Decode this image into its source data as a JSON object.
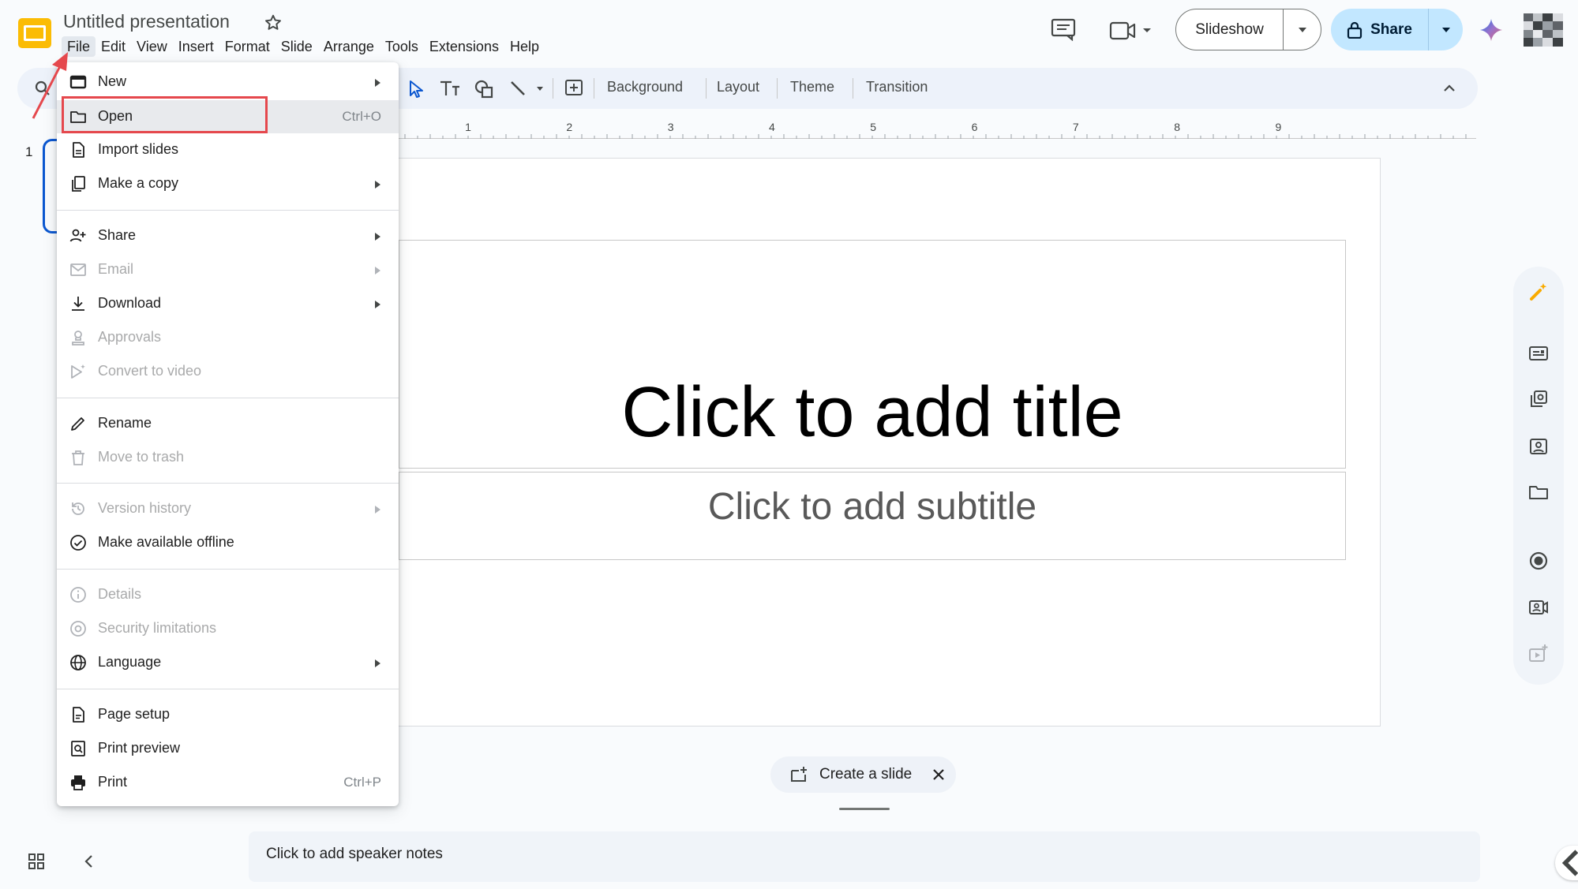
{
  "app": {
    "doc_title": "Untitled presentation",
    "menus": [
      "File",
      "Edit",
      "View",
      "Insert",
      "Format",
      "Slide",
      "Arrange",
      "Tools",
      "Extensions",
      "Help"
    ],
    "active_menu": "File"
  },
  "header": {
    "slideshow_label": "Slideshow",
    "share_label": "Share"
  },
  "toolbar": {
    "background_label": "Background",
    "layout_label": "Layout",
    "theme_label": "Theme",
    "transition_label": "Transition"
  },
  "ruler": {
    "ticks": [
      "1",
      "2",
      "3",
      "4",
      "5",
      "6",
      "7",
      "8",
      "9"
    ]
  },
  "filmstrip": {
    "slide_number": "1"
  },
  "slide": {
    "title_placeholder": "Click to add title",
    "subtitle_placeholder": "Click to add subtitle"
  },
  "create_slide_label": "Create a slide",
  "speaker_notes_placeholder": "Click to add speaker notes",
  "file_menu": {
    "items": [
      {
        "label": "New",
        "icon": "new-presentation-icon",
        "submenu": true,
        "disabled": false
      },
      {
        "label": "Open",
        "icon": "folder-icon",
        "shortcut": "Ctrl+O",
        "disabled": false,
        "highlighted": true
      },
      {
        "label": "Import slides",
        "icon": "import-slides-icon",
        "disabled": false
      },
      {
        "label": "Make a copy",
        "icon": "copy-icon",
        "submenu": true,
        "disabled": false
      },
      {
        "label": "Share",
        "icon": "person-add-icon",
        "submenu": true,
        "disabled": false
      },
      {
        "label": "Email",
        "icon": "email-icon",
        "submenu": true,
        "disabled": true
      },
      {
        "label": "Download",
        "icon": "download-icon",
        "submenu": true,
        "disabled": false
      },
      {
        "label": "Approvals",
        "icon": "approvals-icon",
        "disabled": true
      },
      {
        "label": "Convert to video",
        "icon": "video-icon",
        "disabled": true
      },
      {
        "label": "Rename",
        "icon": "pencil-icon",
        "disabled": false
      },
      {
        "label": "Move to trash",
        "icon": "trash-icon",
        "disabled": true
      },
      {
        "label": "Version history",
        "icon": "history-icon",
        "submenu": true,
        "disabled": true
      },
      {
        "label": "Make available offline",
        "icon": "offline-icon",
        "disabled": false
      },
      {
        "label": "Details",
        "icon": "info-icon",
        "disabled": true
      },
      {
        "label": "Security limitations",
        "icon": "security-icon",
        "disabled": true
      },
      {
        "label": "Language",
        "icon": "globe-icon",
        "submenu": true,
        "disabled": false
      },
      {
        "label": "Page setup",
        "icon": "page-setup-icon",
        "disabled": false
      },
      {
        "label": "Print preview",
        "icon": "print-preview-icon",
        "disabled": false
      },
      {
        "label": "Print",
        "icon": "printer-icon",
        "shortcut": "Ctrl+P",
        "disabled": false
      }
    ]
  },
  "colors": {
    "accent_blue": "#0b57d0",
    "share_bg": "#c2e7ff",
    "annotation_red": "#e5484d",
    "logo_yellow": "#fbbc04"
  }
}
